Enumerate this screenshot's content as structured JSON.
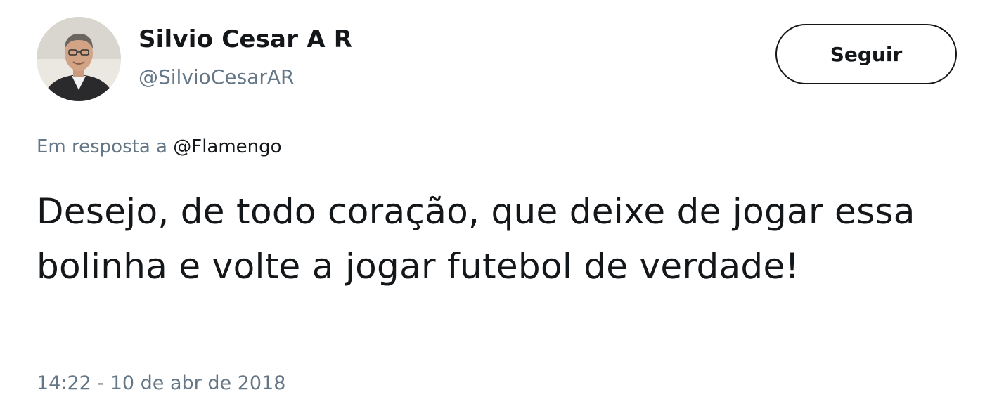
{
  "author": {
    "name": "Silvio Cesar A R",
    "handle": "@SilvioCesarAR"
  },
  "follow_label": "Seguir",
  "reply_context": {
    "prefix": "Em resposta a",
    "handle": "@Flamengo"
  },
  "tweet": {
    "text": "Desejo, de todo coração, que deixe de jogar essa bolinha e volte a jogar futebol de verdade!",
    "timestamp": "14:22 - 10 de abr de 2018"
  },
  "colors": {
    "text_primary": "#14171a",
    "text_secondary": "#657786",
    "background": "#ffffff"
  }
}
